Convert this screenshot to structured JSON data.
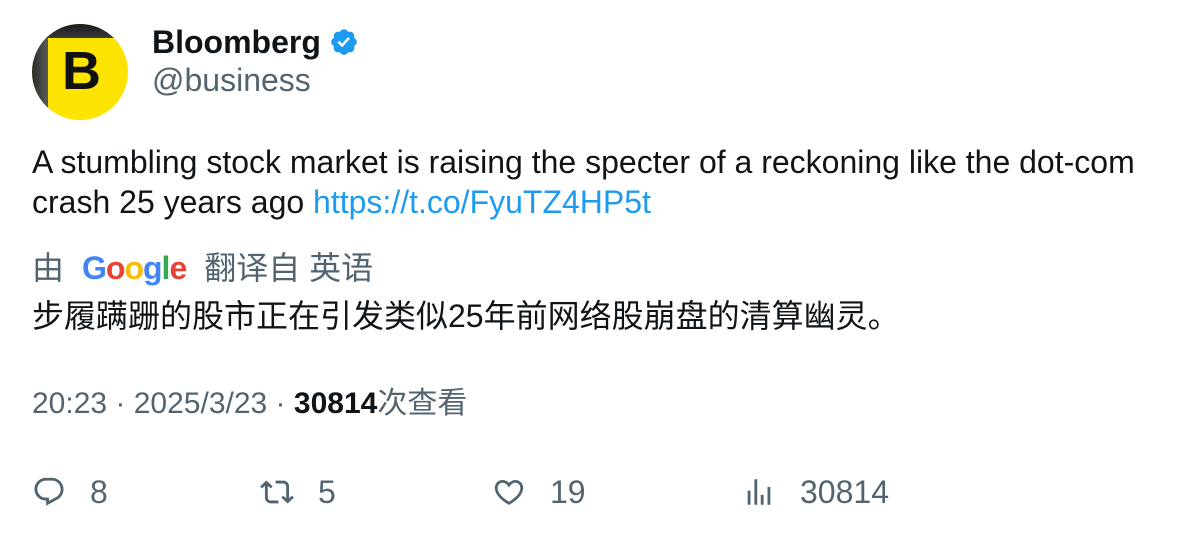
{
  "author": {
    "display_name": "Bloomberg",
    "handle": "@business",
    "avatar_letter": "B",
    "verified": true
  },
  "tweet": {
    "text": "A stumbling stock market is raising the specter of a reckoning like the dot-com crash 25 years ago ",
    "link": "https://t.co/FyuTZ4HP5t"
  },
  "translation": {
    "prefix": "由",
    "provider": "Google",
    "suffix": "翻译自 英语",
    "text": "步履蹒跚的股市正在引发类似25年前网络股崩盘的清算幽灵。"
  },
  "meta": {
    "time": "20:23",
    "separator": " · ",
    "date": "2025/3/23",
    "views_count": "30814",
    "views_label": "次查看"
  },
  "actions": {
    "reply": {
      "count": "8",
      "icon": "reply-icon"
    },
    "retweet": {
      "count": "5",
      "icon": "retweet-icon"
    },
    "like": {
      "count": "19",
      "icon": "like-icon"
    },
    "views": {
      "count": "30814",
      "icon": "views-icon"
    }
  },
  "colors": {
    "text": "#0f1419",
    "secondary": "#536471",
    "link": "#1d9bf0",
    "verified": "#1d9bf0",
    "avatar_bg": "#fce300"
  }
}
